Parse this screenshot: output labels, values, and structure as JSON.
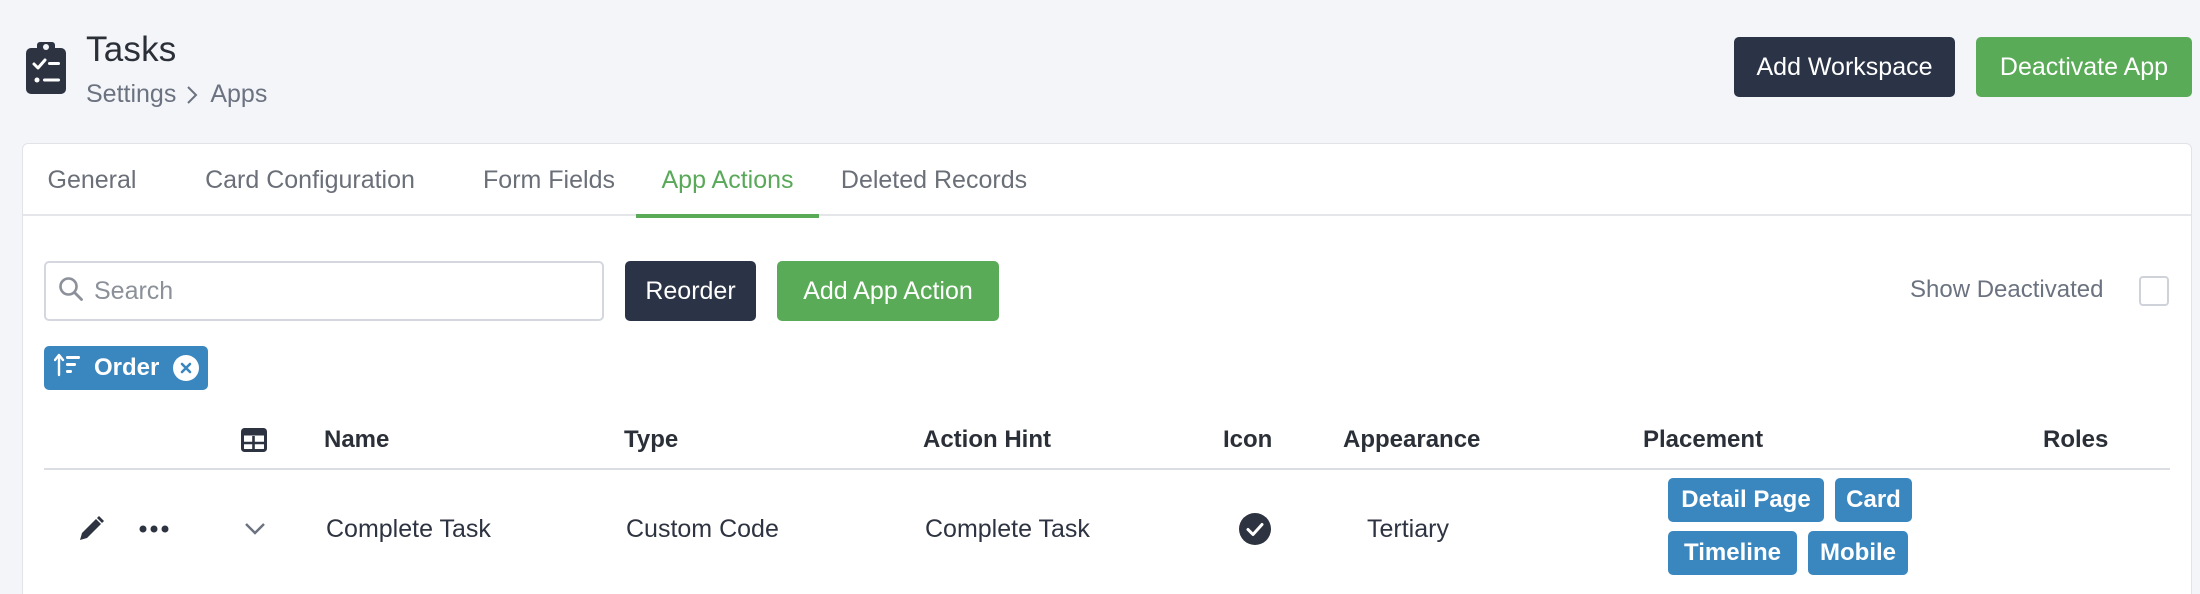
{
  "header": {
    "title": "Tasks",
    "breadcrumb": [
      "Settings",
      "Apps"
    ],
    "add_workspace_label": "Add Workspace",
    "deactivate_app_label": "Deactivate App"
  },
  "tabs": [
    {
      "label": "General",
      "active": false
    },
    {
      "label": "Card Configuration",
      "active": false
    },
    {
      "label": "Form Fields",
      "active": false
    },
    {
      "label": "App Actions",
      "active": true
    },
    {
      "label": "Deleted Records",
      "active": false
    }
  ],
  "toolbar": {
    "search_placeholder": "Search",
    "search_value": "",
    "reorder_label": "Reorder",
    "add_action_label": "Add App Action",
    "show_deactivated_label": "Show Deactivated",
    "show_deactivated_checked": false
  },
  "filter_chip": {
    "label": "Order"
  },
  "table": {
    "columns": [
      "Name",
      "Type",
      "Action Hint",
      "Icon",
      "Appearance",
      "Placement",
      "Roles"
    ],
    "rows": [
      {
        "name": "Complete Task",
        "type": "Custom Code",
        "action_hint": "Complete Task",
        "icon": "check-circle-icon",
        "appearance": "Tertiary",
        "placement": [
          "Detail Page",
          "Card",
          "Timeline",
          "Mobile"
        ],
        "roles": ""
      }
    ]
  },
  "colors": {
    "accent_green": "#5aab57",
    "dark_button": "#2b3446",
    "badge_blue": "#3a87bf",
    "page_background": "#f4f5f9"
  }
}
